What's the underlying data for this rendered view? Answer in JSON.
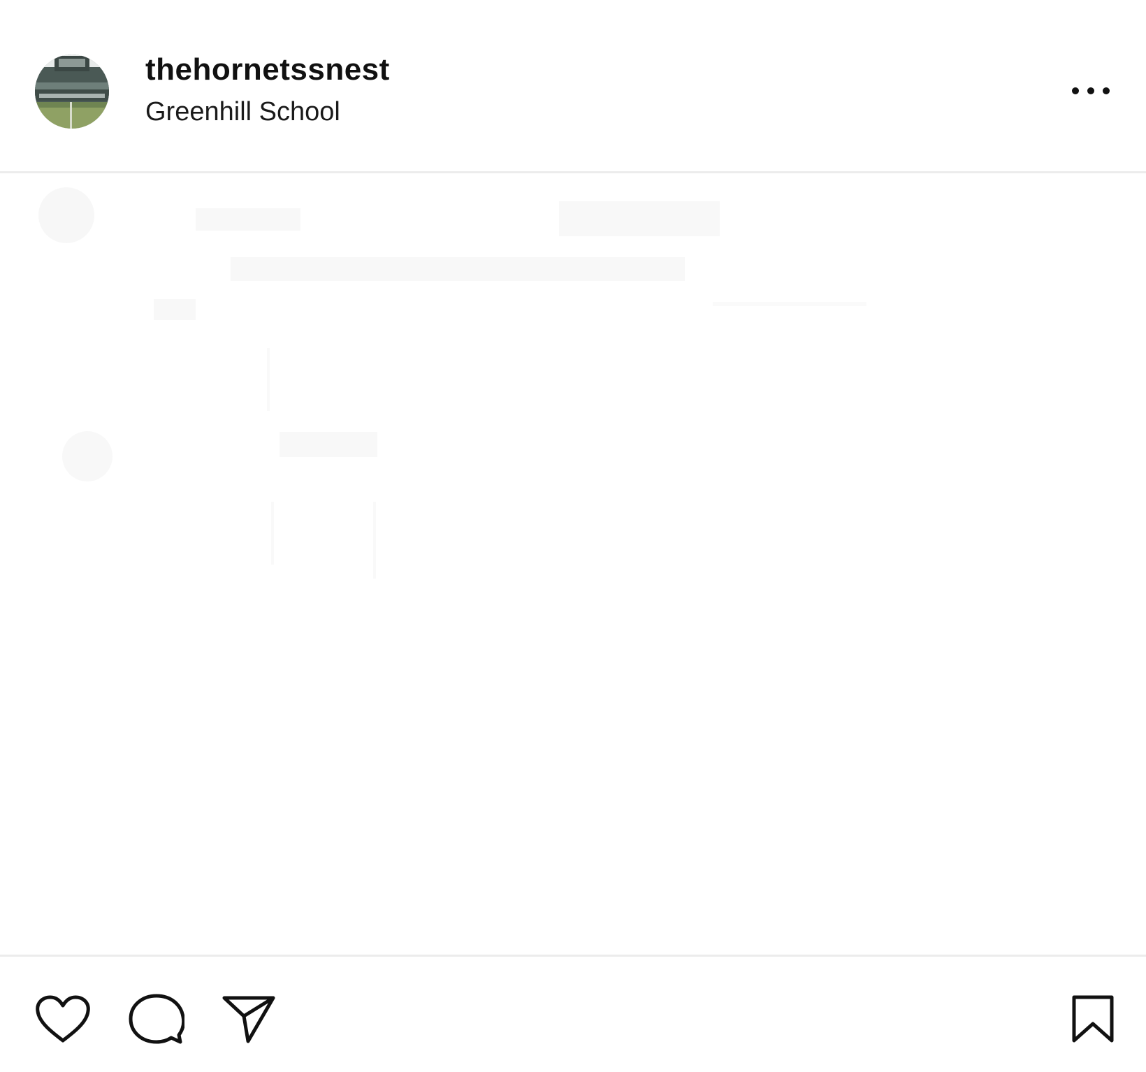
{
  "header": {
    "username": "thehornetssnest",
    "location": "Greenhill School",
    "avatar_icon": "stadium-photo-avatar",
    "more_icon": "more-horizontal-icon"
  },
  "media": {
    "state": "washed-out / nearly blank image"
  },
  "actions": {
    "like_icon": "heart-icon",
    "comment_icon": "comment-bubble-icon",
    "share_icon": "paper-plane-icon",
    "save_icon": "bookmark-icon"
  },
  "colors": {
    "text": "#111111",
    "divider": "#ececec",
    "background": "#ffffff"
  }
}
